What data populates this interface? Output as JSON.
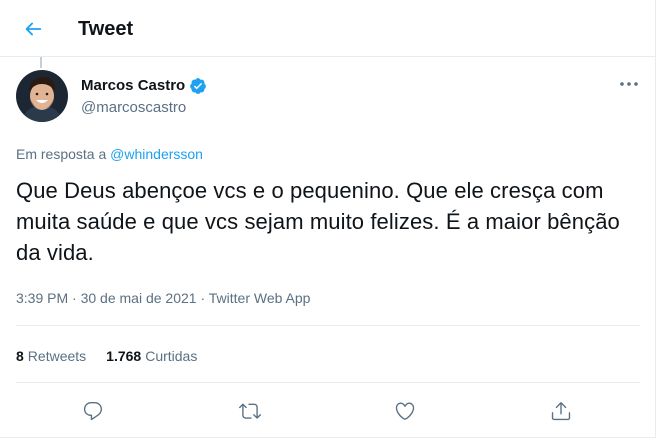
{
  "header": {
    "title": "Tweet",
    "back_icon": "arrow-left-icon"
  },
  "author": {
    "name": "Marcos Castro",
    "handle": "@marcoscastro",
    "verified": true
  },
  "reply": {
    "prefix": "Em resposta a ",
    "mention": "@whindersson"
  },
  "tweet": {
    "text": "Que Deus abençoe vcs e o pequenino. Que ele cresça com muita saúde e que vcs sejam muito felizes. É a maior bênção da vida."
  },
  "meta": {
    "time": "3:39 PM",
    "separator": " · ",
    "date": "30 de mai de 2021",
    "source": "Twitter Web App"
  },
  "stats": {
    "retweets_count": "8",
    "retweets_label": "Retweets",
    "likes_count": "1.768",
    "likes_label": "Curtidas"
  },
  "actions": [
    "reply-icon",
    "retweet-icon",
    "like-icon",
    "share-icon"
  ],
  "colors": {
    "accent": "#1da1f2",
    "text": "#0f1419",
    "muted": "#5b7083",
    "border": "#e6ecf0"
  }
}
